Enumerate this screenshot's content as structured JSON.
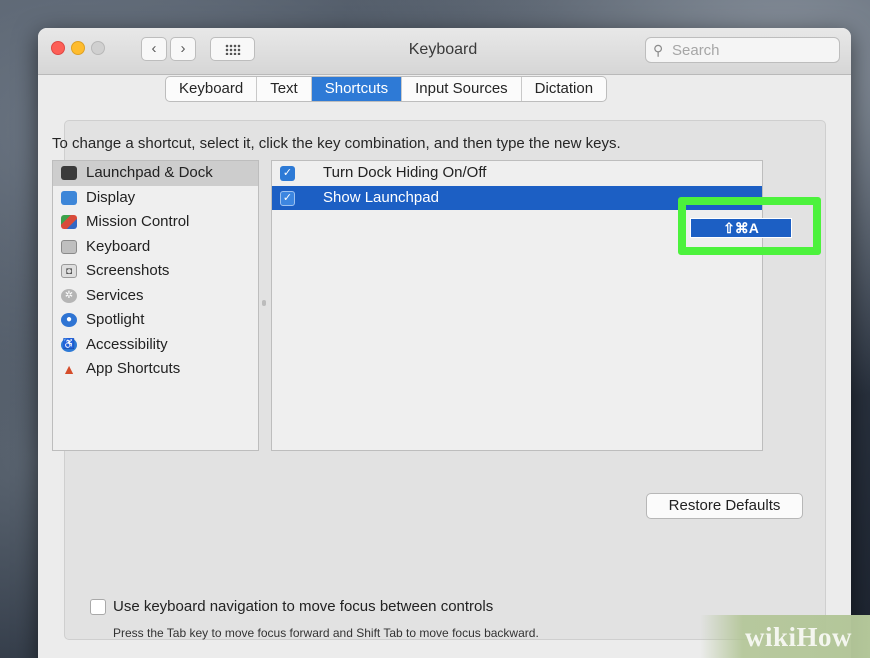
{
  "window": {
    "title": "Keyboard",
    "back_symbol": "‹",
    "forward_symbol": "›",
    "search_placeholder": "Search"
  },
  "tabs": [
    "Keyboard",
    "Text",
    "Shortcuts",
    "Input Sources",
    "Dictation"
  ],
  "active_tab": "Shortcuts",
  "instructions": "To change a shortcut, select it, click the key combination, and then type the new keys.",
  "categories": [
    {
      "label": "Launchpad & Dock",
      "icon": "dock-icon",
      "selected": true
    },
    {
      "label": "Display",
      "icon": "display-icon"
    },
    {
      "label": "Mission Control",
      "icon": "mission-control-icon"
    },
    {
      "label": "Keyboard",
      "icon": "keyboard-icon"
    },
    {
      "label": "Screenshots",
      "icon": "screenshot-icon"
    },
    {
      "label": "Services",
      "icon": "gear-icon"
    },
    {
      "label": "Spotlight",
      "icon": "spotlight-icon"
    },
    {
      "label": "Accessibility",
      "icon": "accessibility-icon"
    },
    {
      "label": "App Shortcuts",
      "icon": "app-store-icon"
    }
  ],
  "shortcuts": [
    {
      "label": "Turn Dock Hiding On/Off",
      "checked": true,
      "keys": ""
    },
    {
      "label": "Show Launchpad",
      "checked": true,
      "keys": "⇧⌘A",
      "selected": true
    }
  ],
  "restore_button": "Restore Defaults",
  "keyboard_navigation": {
    "label": "Use keyboard navigation to move focus between controls",
    "checked": false,
    "hint": "Press the Tab key to move focus forward and Shift Tab to move focus backward."
  },
  "watermark": "wikiHow",
  "colors": {
    "accent": "#2e7ad6",
    "selection": "#1c5fc4",
    "highlight_box": "#4cf23c"
  }
}
